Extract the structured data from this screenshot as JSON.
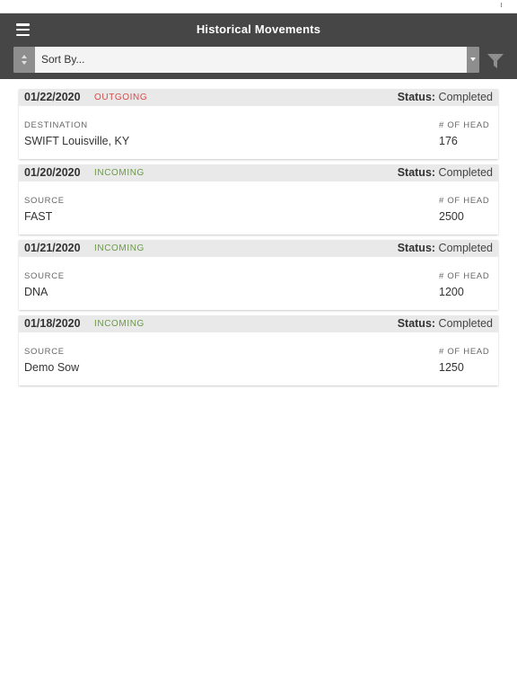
{
  "header": {
    "title": "Historical Movements"
  },
  "toolbar": {
    "sort_label": "Sort By..."
  },
  "icons": {
    "menu": "hamburger-menu-icon",
    "filter": "filter-funnel-icon",
    "sort": "up-down-arrows-icon",
    "dropdown": "caret-down-icon"
  },
  "colors": {
    "navbar": "#464646",
    "outgoing": "#d84a4a",
    "incoming": "#6a9a45",
    "card_header": "#e9e9e9"
  },
  "labels": {
    "status_prefix": "Status:",
    "head_count": "# OF HEAD"
  },
  "movements": [
    {
      "date": "01/22/2020",
      "direction": "OUTGOING",
      "status": "Completed",
      "location_label": "DESTINATION",
      "location": "SWIFT Louisville, KY",
      "head": "176"
    },
    {
      "date": "01/20/2020",
      "direction": "INCOMING",
      "status": "Completed",
      "location_label": "SOURCE",
      "location": "FAST",
      "head": "2500"
    },
    {
      "date": "01/21/2020",
      "direction": "INCOMING",
      "status": "Completed",
      "location_label": "SOURCE",
      "location": "DNA",
      "head": "1200"
    },
    {
      "date": "01/18/2020",
      "direction": "INCOMING",
      "status": "Completed",
      "location_label": "SOURCE",
      "location": "Demo Sow",
      "head": "1250"
    }
  ]
}
